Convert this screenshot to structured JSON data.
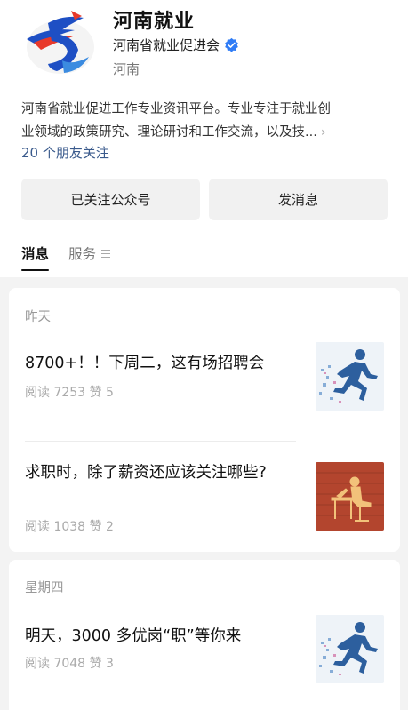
{
  "account": {
    "name": "河南就业",
    "org": "河南省就业促进会",
    "region": "河南",
    "description_line1": "河南省就业促进工作专业资讯平台。专业专注于就业创",
    "description_line2": "业领域的政策研究、理论研讨和工作交流，以及技...",
    "friends_following": "20 个朋友关注",
    "brand_color": "#1e4fc4",
    "verified_color": "#2f7cf6"
  },
  "actions": {
    "follow_label": "已关注公众号",
    "message_label": "发消息"
  },
  "tabs": {
    "messages": "消息",
    "service": "服务"
  },
  "feed": {
    "groups": [
      {
        "day": "昨天",
        "articles": [
          {
            "title": "8700+！！下周二，这有场招聘会",
            "meta": "阅读 7253  赞 5",
            "thumb_icon": "running-man-icon"
          },
          {
            "title": "求职时，除了薪资还应该关注哪些?",
            "meta": "阅读 1038  赞 2",
            "thumb_icon": "desk-worker-icon"
          }
        ]
      },
      {
        "day": "星期四",
        "articles": [
          {
            "title": "明天，3000 多优岗“职”等你来",
            "meta": "阅读 7048  赞 3",
            "thumb_icon": "running-man-icon"
          }
        ]
      }
    ]
  }
}
